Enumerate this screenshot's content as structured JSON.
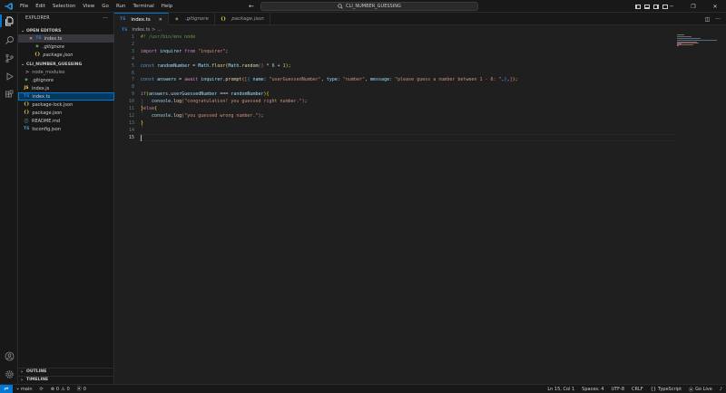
{
  "titlebar": {
    "menus": [
      "File",
      "Edit",
      "Selection",
      "View",
      "Go",
      "Run",
      "Terminal",
      "Help"
    ],
    "search_text": "CLI_NUMBER_GUESSING",
    "back_arrow": "←",
    "forward_arrow": "→",
    "minimize": "─",
    "maximize": "❐",
    "close": "✕"
  },
  "sidebar": {
    "title": "EXPLORER",
    "more": "···",
    "open_editors": {
      "label": "OPEN EDITORS",
      "items": [
        {
          "close": "✕",
          "badge": "TS",
          "name": "index.ts"
        },
        {
          "badge": "◆",
          "name": ".gitignore"
        },
        {
          "badge": "{}",
          "name": "package.json"
        }
      ]
    },
    "project": {
      "label": "CLI_NUMBER_GUESSING",
      "items": [
        {
          "chevron": ">",
          "name": "node_modules"
        },
        {
          "badge": "◆",
          "name": ".gitignore"
        },
        {
          "badge": "JS",
          "name": "index.js"
        },
        {
          "badge": "TS",
          "name": "index.ts"
        },
        {
          "badge": "{}",
          "name": "package-lock.json"
        },
        {
          "badge": "{}",
          "name": "package.json"
        },
        {
          "badge": "ⓘ",
          "name": "README.md"
        },
        {
          "badge": "TS",
          "name": "tsconfig.json"
        }
      ]
    },
    "outline": "OUTLINE",
    "timeline": "TIMELINE"
  },
  "tabs": [
    {
      "badge": "TS",
      "label": "index.ts",
      "close": "✕",
      "active": true
    },
    {
      "badge": "◆",
      "label": ".gitignore",
      "active": false
    },
    {
      "badge": "{}",
      "label": "package.json",
      "active": false
    }
  ],
  "breadcrumb": {
    "badge": "TS",
    "file": "index.ts",
    "sep": ">",
    "rest": "..."
  },
  "editor": {
    "line_numbers": [
      "1",
      "2",
      "3",
      "4",
      "5",
      "6",
      "7",
      "8",
      "9",
      "10",
      "11",
      "12",
      "13",
      "14",
      "15"
    ],
    "current_line": "15",
    "code": {
      "l1": "#! /usr/bin/env node",
      "l3_kw": "import",
      "l3_var": "inquirer",
      "l3_from": "from",
      "l3_str": "\"inquirer\"",
      "l3_end": ";",
      "l5_kw": "const",
      "l5_var": "randomNumber",
      "l5_eq": " = ",
      "l5_math1": "Math",
      "l5_floor": "floor",
      "l5_math2": "Math",
      "l5_random": "random",
      "l5_mul": " * ",
      "l5_n6": "6",
      "l5_plus": " + ",
      "l5_n1": "1",
      "l5_end": ";",
      "l7_kw": "const",
      "l7_var": "answers",
      "l7_eq": " = ",
      "l7_await": "await",
      "l7_inq": "inquirer",
      "l7_prompt": "prompt",
      "l7_name_key": "name",
      "l7_name_val": "\"userGuessedNumber\"",
      "l7_type_key": "type",
      "l7_type_val": "\"number\"",
      "l7_msg_key": "message",
      "l7_msg_val": "\"please guess a number between 1 - 6: \"",
      "l9_if": "if",
      "l9_ans": "answers",
      "l9_prop": "userGuessedNumber",
      "l9_op": " === ",
      "l9_rand": "randomNumber",
      "l10_console": "console",
      "l10_log": "log",
      "l10_str": "\"congratulation! you guessed right number.\"",
      "l11_else": "else",
      "l12_console": "console",
      "l12_log": "log",
      "l12_str": "\"you guessed wrong number.\""
    }
  },
  "statusbar": {
    "remote": "⇌",
    "branch": "main",
    "sync": "⟳",
    "errors": "0",
    "warnings": "0",
    "ports": "0",
    "position": "Ln 15, Col 1",
    "spaces": "Spaces: 4",
    "encoding": "UTF-8",
    "eol": "CRLF",
    "braces": "{}",
    "language": "TypeScript",
    "golive": "Go Live",
    "bell": "🔔"
  },
  "colors": {
    "accent": "#0078d4",
    "ts_badge": "#3178c6",
    "json_badge": "#e8d44d"
  }
}
